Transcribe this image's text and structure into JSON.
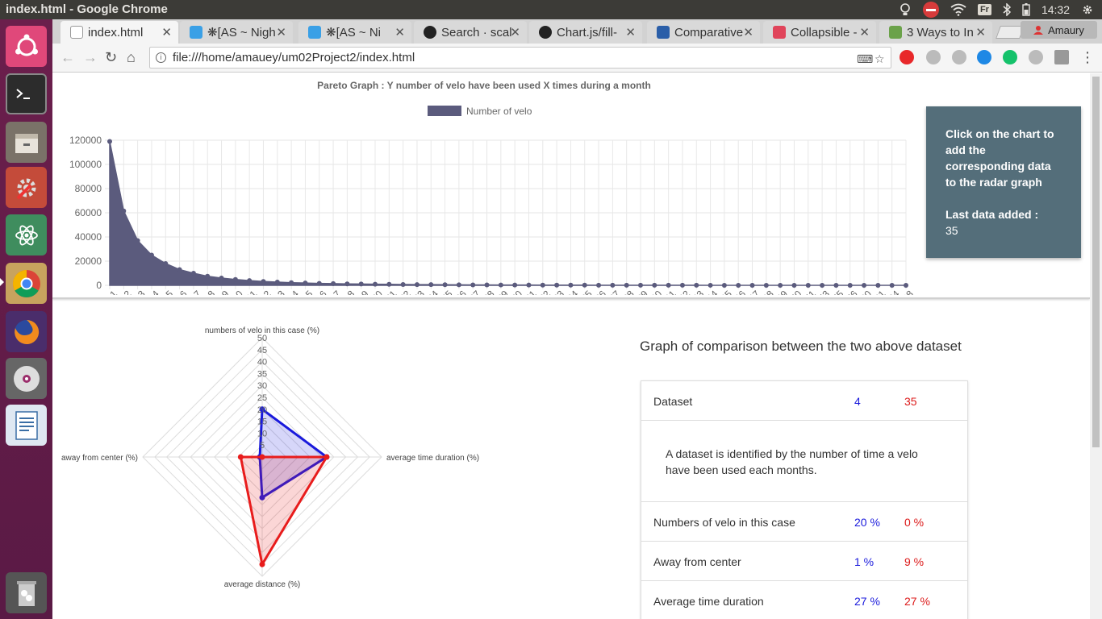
{
  "system": {
    "window_title": "index.html - Google Chrome",
    "lang": "Fr",
    "time": "14:32",
    "user": "Amaury"
  },
  "launcher": {
    "items": [
      "ubuntu-icon",
      "terminal-icon",
      "files-icon",
      "settings-icon",
      "atom-icon",
      "chrome-icon",
      "firefox-icon",
      "dvd-icon",
      "writer-icon",
      "trash-icon"
    ]
  },
  "tabs": [
    {
      "label": "index.html",
      "active": true,
      "favicon_color": "#eeeeee"
    },
    {
      "label": "❋[AS ~ Nigh",
      "active": false,
      "favicon_color": "#3aa0e6"
    },
    {
      "label": "❋[AS ~ Ni",
      "active": false,
      "favicon_color": "#3aa0e6"
    },
    {
      "label": "Search · scal",
      "active": false,
      "favicon_color": "#222222"
    },
    {
      "label": "Chart.js/fill-",
      "active": false,
      "favicon_color": "#222222"
    },
    {
      "label": "Comparative",
      "active": false,
      "favicon_color": "#2a5ea8"
    },
    {
      "label": "Collapsible -",
      "active": false,
      "favicon_color": "#e0445a"
    },
    {
      "label": "3 Ways to In",
      "active": false,
      "favicon_color": "#6ba24a"
    }
  ],
  "toolbar": {
    "url": "file:///home/amauey/um02Project2/index.html"
  },
  "pareto": {
    "title": "Pareto Graph : Y number of velo have been used X times during a month",
    "legend_label": "Number of velo",
    "color": "#5b5b7d"
  },
  "info_card": {
    "instruction": "Click on the chart to add the corresponding data to the radar graph",
    "last_label": "Last data added :",
    "last_value": "35"
  },
  "comparison": {
    "title": "Graph of comparison between the two above dataset",
    "header": {
      "label": "Dataset",
      "a": "4",
      "b": "35"
    },
    "description": "A dataset is identified by the number of time a velo have been used each months.",
    "rows": [
      {
        "label": "Numbers of velo in this case",
        "a": "20 %",
        "b": "0 %"
      },
      {
        "label": "Away from center",
        "a": "1 %",
        "b": "9 %"
      },
      {
        "label": "Average time duration",
        "a": "27 %",
        "b": "27 %"
      }
    ]
  },
  "chart_data": [
    {
      "type": "area",
      "title": "Pareto Graph : Y number of velo have been used X times during a month",
      "xlabel": "",
      "ylabel": "",
      "ylim": [
        0,
        120000
      ],
      "yticks": [
        0,
        20000,
        40000,
        60000,
        80000,
        100000,
        120000
      ],
      "grid": true,
      "legend": "top",
      "categories": [
        "1",
        "2",
        "3",
        "4",
        "5",
        "6",
        "7",
        "8",
        "9",
        "10",
        "11",
        "12",
        "13",
        "14",
        "15",
        "16",
        "17",
        "18",
        "19",
        "20",
        "21",
        "22",
        "23",
        "24",
        "25",
        "26",
        "27",
        "28",
        "29",
        "30",
        "31",
        "32",
        "33",
        "34",
        "35",
        "36",
        "37",
        "38",
        "39",
        "40",
        "41",
        "42",
        "43",
        "44",
        "45",
        "46",
        "47",
        "48",
        "49",
        "50",
        "51",
        "53",
        "55",
        "56",
        "60",
        "61",
        "84",
        "98"
      ],
      "series": [
        {
          "name": "Number of velo",
          "color": "#5b5b7d",
          "values": [
            119000,
            61500,
            37000,
            25000,
            18000,
            13000,
            10000,
            7500,
            6000,
            4800,
            3900,
            3200,
            2700,
            2200,
            1900,
            1600,
            1400,
            1200,
            1050,
            900,
            800,
            700,
            620,
            550,
            480,
            420,
            370,
            330,
            290,
            260,
            230,
            200,
            180,
            160,
            140,
            120,
            105,
            90,
            80,
            70,
            60,
            52,
            45,
            40,
            35,
            30,
            26,
            22,
            19,
            16,
            12,
            9,
            7,
            5,
            3,
            2,
            1,
            1
          ]
        }
      ]
    },
    {
      "type": "radar",
      "title": "",
      "axes": [
        "numbers of velo in this case (%)",
        "average time duration (%)",
        "average distance (%)",
        "away from center (%)"
      ],
      "rlim": [
        0,
        50
      ],
      "rticks": [
        "50",
        "45",
        "40",
        "35",
        "30",
        "25",
        "20",
        "15",
        "10",
        "5"
      ],
      "series": [
        {
          "name": "4",
          "color": "#1a1adc",
          "fill": "rgba(26,26,220,0.18)",
          "values": [
            20,
            27,
            17,
            1
          ]
        },
        {
          "name": "35",
          "color": "#e81c1c",
          "fill": "rgba(232,28,28,0.18)",
          "values": [
            0,
            27,
            45,
            9
          ]
        }
      ]
    }
  ]
}
